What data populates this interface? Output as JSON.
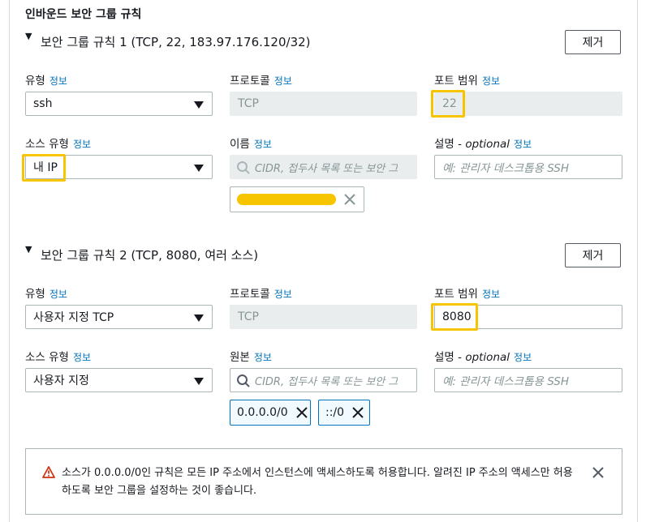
{
  "section": {
    "title": "인바운드 보안 그룹 규칙"
  },
  "info_link": "정보",
  "rules": [
    {
      "title": "보안 그룹 규칙 1 (TCP, 22, 183.97.176.120/32)",
      "remove_label": "제거",
      "type_label": "유형",
      "type_value": "ssh",
      "protocol_label": "프로토콜",
      "protocol_value": "TCP",
      "port_label": "포트 범위",
      "port_value": "22",
      "source_type_label": "소스 유형",
      "source_type_value": "내 IP",
      "source_label": "이름",
      "source_placeholder": "CIDR, 접두사 목록 또는 보안 그",
      "desc_label": "설명",
      "desc_optional": "optional",
      "desc_placeholder": "예: 관리자 데스크톱용 SSH",
      "tokens": []
    },
    {
      "title": "보안 그룹 규칙 2 (TCP, 8080, 여러 소스)",
      "remove_label": "제거",
      "type_label": "유형",
      "type_value": "사용자 지정 TCP",
      "protocol_label": "프로토콜",
      "protocol_value": "TCP",
      "port_label": "포트 범위",
      "port_value": "8080",
      "source_type_label": "소스 유형",
      "source_type_value": "사용자 지정",
      "source_label": "원본",
      "source_placeholder": "CIDR, 접두사 목록 또는 보안 그",
      "desc_label": "설명",
      "desc_optional": "optional",
      "desc_placeholder": "예: 관리자 데스크톱용 SSH",
      "tokens": [
        "0.0.0.0/0",
        "::/0"
      ]
    }
  ],
  "alert": {
    "message": "소스가 0.0.0.0/0인 규칙은 모든 IP 주소에서 인스턴스에 액세스하도록 허용합니다. 알려진 IP 주소의 액세스만 허용하도록 보안 그룹을 설정하는 것이 좋습니다."
  },
  "colors": {
    "highlight": "#f7c500",
    "link": "#0073bb",
    "warning": "#d13212"
  },
  "icons": [
    "caret-down-icon",
    "search-icon",
    "close-icon",
    "warning-icon"
  ]
}
